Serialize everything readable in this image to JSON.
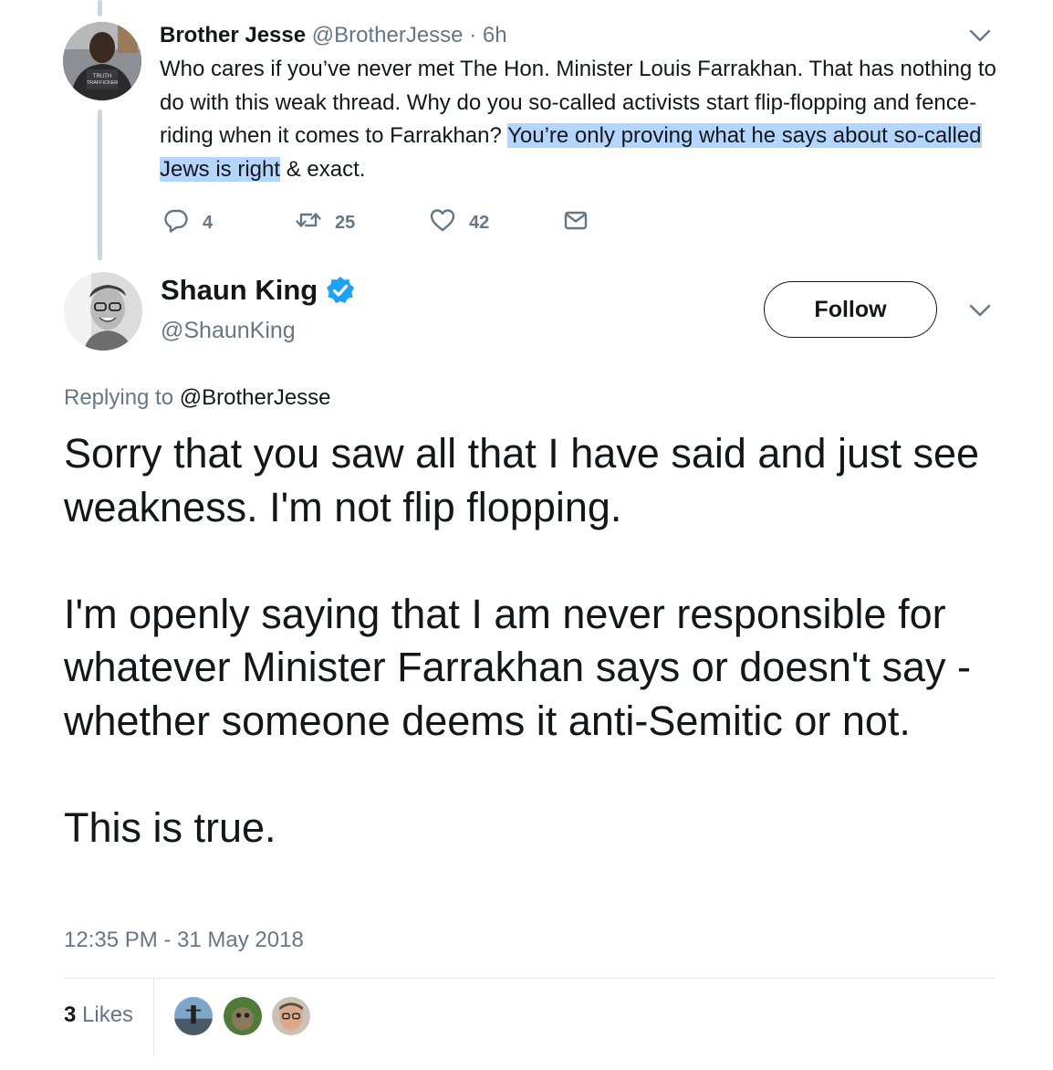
{
  "parent_tweet": {
    "name": "Brother Jesse",
    "handle": "@BrotherJesse",
    "separator": "·",
    "time": "6h",
    "text_before": "Who cares if you’ve never met The Hon. Minister Louis Farrakhan. That has nothing to do with this weak thread. Why do you so-called activists start flip-flopping and fence-riding when it comes to Farrakhan? ",
    "text_highlighted": "You’re only proving what he says about so-called Jews is right",
    "text_after": " & exact.",
    "actions": {
      "reply_count": "4",
      "retweet_count": "25",
      "like_count": "42"
    },
    "avatar_shirt_text": "TRUTH TRAFFICKER"
  },
  "main_tweet": {
    "name": "Shaun King",
    "handle": "@ShaunKing",
    "follow_label": "Follow",
    "replying_prefix": "Replying to",
    "replying_handle": "@BrotherJesse",
    "paragraphs": [
      "Sorry that you saw all that I have said and just see weakness. I'm not flip flopping.",
      "I'm openly saying that I am never responsible for whatever Minister Farrakhan says or doesn't say - whether someone deems it anti-Semitic or not.",
      "This is true."
    ],
    "timestamp": "12:35 PM - 31 May 2018",
    "likes_count": "3",
    "likes_label": "Likes"
  },
  "colors": {
    "text": "#14171a",
    "secondary": "#657786",
    "highlight": "#b4d5fe",
    "verified": "#1da1f2",
    "divider": "#e1e8ed",
    "thread_line": "#ccd6dd"
  },
  "icons": [
    "chevron-down-icon",
    "reply-icon",
    "retweet-icon",
    "like-icon",
    "dm-icon",
    "verified-icon"
  ]
}
